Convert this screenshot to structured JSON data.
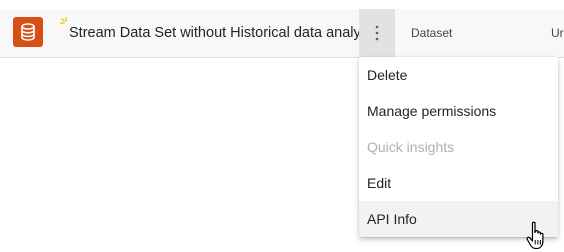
{
  "row": {
    "name": "Stream Data Set without Historical data analy...",
    "type": "Dataset",
    "owner": "Ur",
    "item_icon": "database-icon",
    "new_indicator_icon": "sparkle-icon",
    "more_icon": "vertical-ellipsis-icon"
  },
  "menu": {
    "items": [
      {
        "label": "Delete",
        "disabled": false
      },
      {
        "label": "Manage permissions",
        "disabled": false
      },
      {
        "label": "Quick insights",
        "disabled": true
      },
      {
        "label": "Edit",
        "disabled": false
      },
      {
        "label": "API Info",
        "disabled": false,
        "hovered": true
      }
    ]
  },
  "cursor_icon": "hand-pointer-icon",
  "colors": {
    "accent": "#d64f14",
    "new_indicator": "#f2c811",
    "row_background": "#f8f8f8",
    "more_button_background": "#e3e2e1",
    "disabled_text": "#b3b0ad",
    "hover_background": "#f3f2f1"
  }
}
